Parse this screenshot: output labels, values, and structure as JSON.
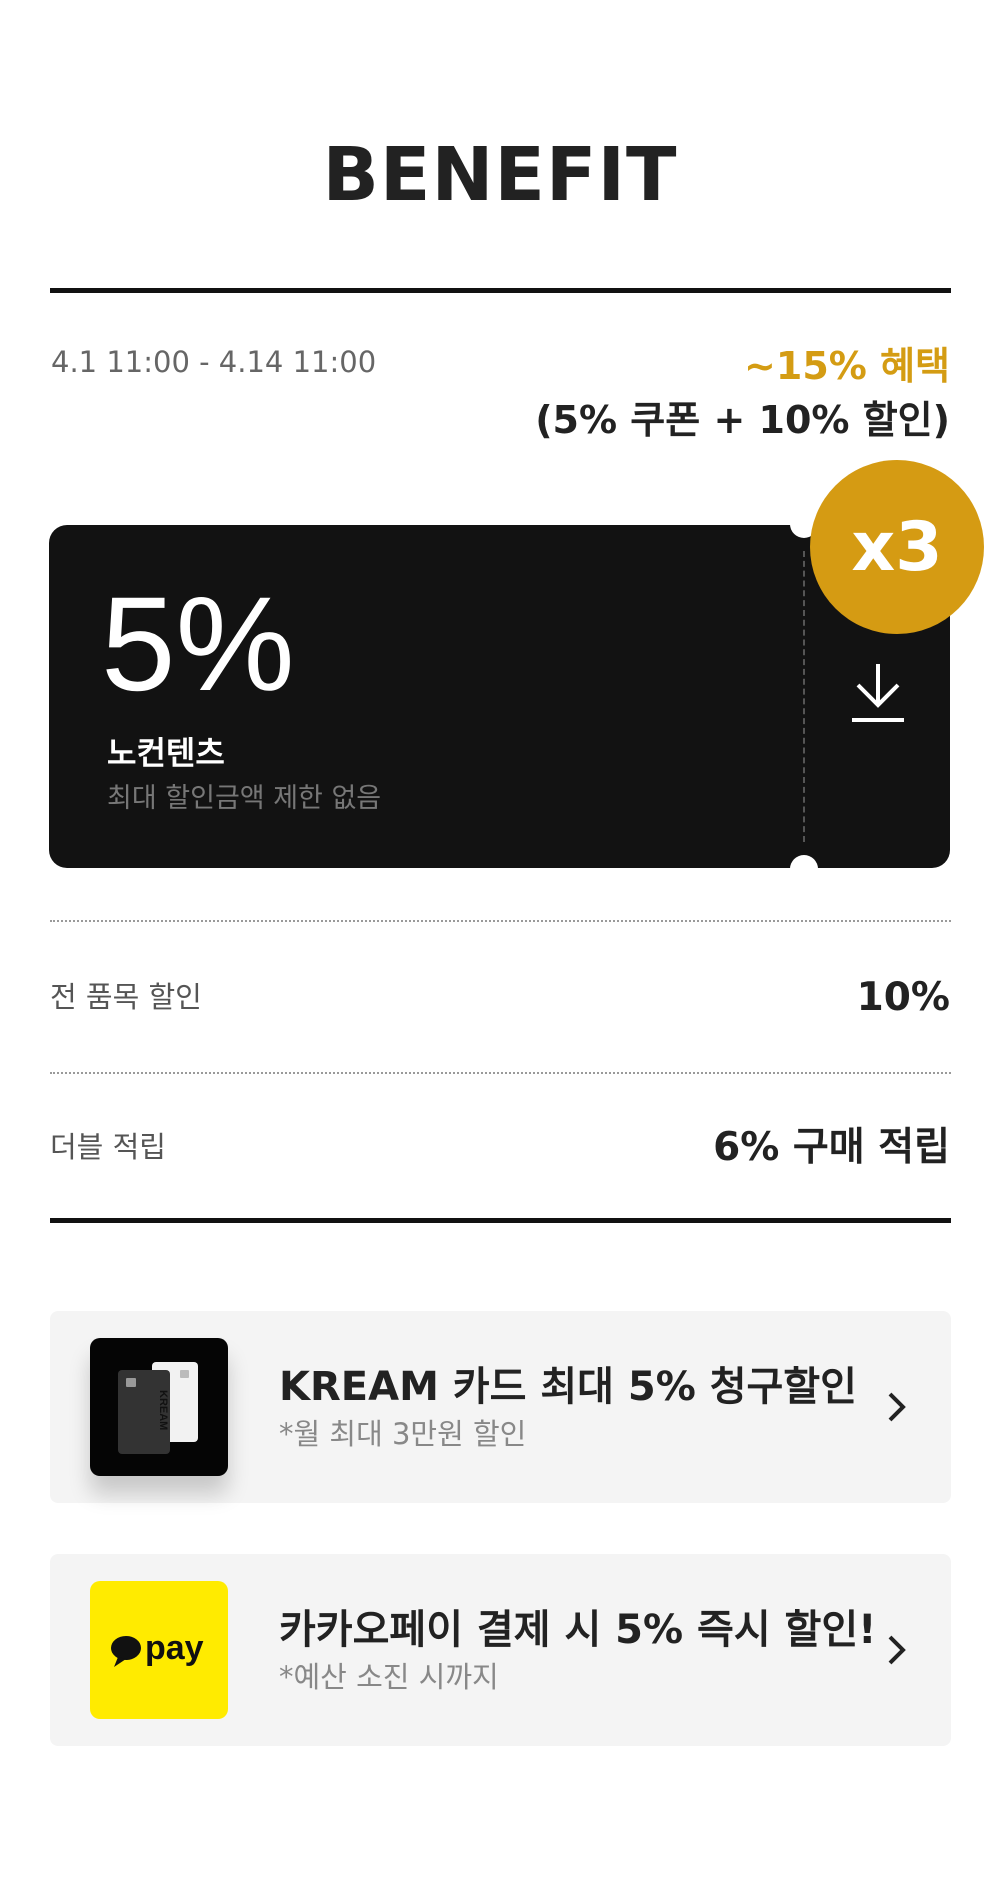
{
  "header": {
    "title": "BENEFIT"
  },
  "period": "4.1 11:00 - 4.14 11:00",
  "summary": {
    "accent": "~15% 혜택",
    "detail": "(5% 쿠폰 + 10% 할인)"
  },
  "coupon": {
    "percent": "5%",
    "name": "노컨텐츠",
    "description": "최대 할인금액 제한 없음",
    "badge": "x3",
    "download_icon": "download-icon"
  },
  "benefits": [
    {
      "label": "전 품목 할인",
      "value": "10%"
    },
    {
      "label": "더블 적립",
      "value": "6% 구매 적립"
    }
  ],
  "banners": [
    {
      "title": "KREAM 카드 최대 5% 청구할인",
      "subtitle": "*월 최대 3만원 할인",
      "icon": "kream-card-icon",
      "card_text": "KREAM"
    },
    {
      "title": "카카오페이 결제 시 5% 즉시 할인!",
      "subtitle": "*예산 소진 시까지",
      "icon": "kakaopay-icon",
      "logo_text": "pay"
    }
  ],
  "colors": {
    "accent": "#d49c13",
    "coupon_bg": "#121212",
    "banner_bg": "#f4f4f4",
    "kakao_yellow": "#ffeb00"
  }
}
